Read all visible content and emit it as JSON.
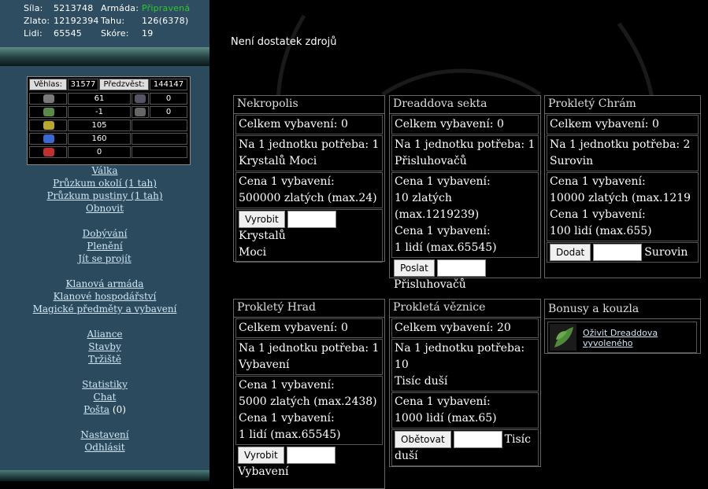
{
  "stats": {
    "sila_label": "Síla:",
    "sila": "5213748",
    "armada_label": "Armáda:",
    "armada": "Připravená",
    "zlato_label": "Zlato:",
    "zlato": "12192394",
    "tahu_label": "Tahu:",
    "tahu": "126(6378)",
    "lidi_label": "Lidi:",
    "lidi": "65545",
    "skore_label": "Skóre:",
    "skore": "19"
  },
  "resources": {
    "vehlas_label": "Věhlas:",
    "vehlas": "31577",
    "predzvest_label": "Předzvěst:",
    "predzvest": "144147",
    "rows": [
      {
        "icon": "gray-gem-icon",
        "value": "61",
        "icon2": "gray-ore-icon",
        "value2": "0"
      },
      {
        "icon": "green-ore-icon",
        "value": "-1",
        "icon2": "gray-stone-icon",
        "value2": "0"
      },
      {
        "icon": "yellow-ore-icon",
        "value": "105"
      },
      {
        "icon": "blue-gem-icon",
        "value": "160"
      },
      {
        "icon": "red-gem-icon",
        "value": "0"
      }
    ]
  },
  "nav": {
    "valka": "Válka",
    "pruzkum_okoli": "Průzkum okolí (1 tah)",
    "pruzkum_pustiny": "Průzkum pustiny (1 tah)",
    "obnovit": "Obnovit",
    "dobyvani": "Dobývání",
    "pleneni": "Plenění",
    "jit_se_projit": "Jít se projít",
    "klanova_armada": "Klanová armáda",
    "klanove_hospodarstvi": "Klanové hospodářství",
    "magicke_predmety": "Magické předměty a vybavení",
    "aliance": "Aliance",
    "stavby": "Stavby",
    "trziste": "Tržiště",
    "statistiky": "Statistiky",
    "chat": "Chat",
    "posta": "Pošta",
    "posta_count": "(0)",
    "nastaveni": "Nastavení",
    "odhlasit": "Odhlásit"
  },
  "message": "Není dostatek zdrojů",
  "cards": {
    "nekropolis": {
      "title": "Nekropolis",
      "total": "Celkem vybavení: 0",
      "need1": "Na 1 jednotku potřeba: 1",
      "need2": "Krystalů Moci",
      "cost_label": "Cena 1 vybavení:",
      "cost": "500000 zlatých (max.24)",
      "button": "Vyrobit",
      "unit1": "Krystalů",
      "unit2": "Moci"
    },
    "dreaddova": {
      "title": "Dreaddova sekta",
      "total": "Celkem vybavení: 0",
      "need1": "Na 1 jednotku potřeba: 1",
      "need2": "Přisluhovačů",
      "cost_label": "Cena 1 vybavení:",
      "cost": "10 zlatých (max.1219239)",
      "cost2_label": "Cena 1 vybavení:",
      "cost2": "1 lidí (max.65545)",
      "button": "Poslat",
      "unit": "Přisluhovačů"
    },
    "chram": {
      "title": "Prokletý Chrám",
      "total": "Celkem vybavení: 0",
      "need1": "Na 1 jednotku potřeba: 2",
      "need2": "Surovin",
      "cost_label": "Cena 1 vybavení:",
      "cost": "10000 zlatých (max.1219",
      "cost2_label": "Cena 1 vybavení:",
      "cost2": "100 lidí (max.655)",
      "button": "Dodat",
      "unit": "Surovin"
    },
    "hrad": {
      "title": "Prokletý Hrad",
      "total": "Celkem vybavení: 0",
      "need1": "Na 1 jednotku potřeba: 1",
      "need2": "Vybavení",
      "cost_label": "Cena 1 vybavení:",
      "cost": "5000 zlatých (max.2438)",
      "cost2_label": "Cena 1 vybavení:",
      "cost2": "1 lidí (max.65545)",
      "button": "Vyrobit",
      "unit": "Vybavení"
    },
    "veznice": {
      "title": "Prokletá věznice",
      "total": "Celkem vybavení: 20",
      "need1": "Na 1 jednotku potřeba: 10",
      "need2": "Tisíc duší",
      "cost_label": "Cena 1 vybavení:",
      "cost": "1000 lidí (max.65)",
      "button": "Obětovat",
      "unit1": "Tisíc",
      "unit2": "duší"
    }
  },
  "bonus": {
    "title": "Bonusy a kouzla",
    "link1": "Oživit Dreaddova",
    "link2": "vyvoleného",
    "icon": "herb-leaf-icon"
  },
  "colors": {
    "sidebar": "#2c4a5e",
    "armada_status": "#2ec82e",
    "link": "#cfe6f4"
  }
}
